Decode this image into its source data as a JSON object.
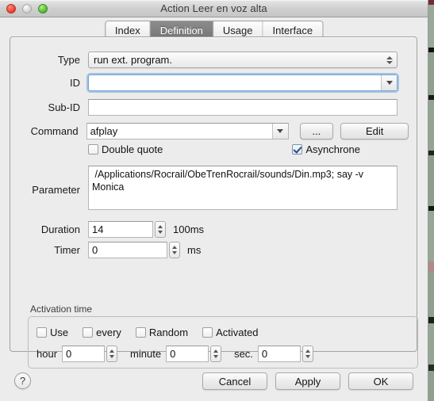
{
  "window": {
    "title": "Action Leer en voz alta",
    "traffic_lights": [
      "close-button",
      "minimize-button",
      "zoom-button"
    ]
  },
  "tabs": [
    {
      "label": "Index",
      "selected": false
    },
    {
      "label": "Definition",
      "selected": true
    },
    {
      "label": "Usage",
      "selected": false
    },
    {
      "label": "Interface",
      "selected": false
    }
  ],
  "form": {
    "type": {
      "label": "Type",
      "value": "run ext. program."
    },
    "id": {
      "label": "ID",
      "value": "",
      "placeholder": ""
    },
    "subid": {
      "label": "Sub-ID",
      "value": "",
      "placeholder": ""
    },
    "command": {
      "label": "Command",
      "value": "afplay",
      "browse_label": "...",
      "edit_label": "Edit",
      "double_quote_label": "Double quote",
      "double_quote_checked": false,
      "asynchrone_label": "Asynchrone",
      "asynchrone_checked": true
    },
    "parameter": {
      "label": "Parameter",
      "value": " /Applications/Rocrail/ObeTrenRocrail/sounds/Din.mp3; say -v Monica"
    },
    "duration": {
      "label": "Duration",
      "value": "14",
      "unit": "100ms"
    },
    "timer": {
      "label": "Timer",
      "value": "0",
      "unit": "ms"
    }
  },
  "activation": {
    "title": "Activation time",
    "checkboxes": [
      {
        "label": "Use",
        "checked": false
      },
      {
        "label": "every",
        "checked": false
      },
      {
        "label": "Random",
        "checked": false
      },
      {
        "label": "Activated",
        "checked": false
      }
    ],
    "hour": {
      "label": "hour",
      "value": "0"
    },
    "minute": {
      "label": "minute",
      "value": "0"
    },
    "sec": {
      "label": "sec.",
      "value": "0"
    }
  },
  "footer": {
    "help_label": "?",
    "cancel_label": "Cancel",
    "apply_label": "Apply",
    "ok_label": "OK"
  },
  "colors": {
    "window_bg": "#ececec",
    "selected_tab_bg": "#7b7b7b",
    "focus_ring": "#6fa8dc",
    "check_mark": "#2d4f77"
  }
}
